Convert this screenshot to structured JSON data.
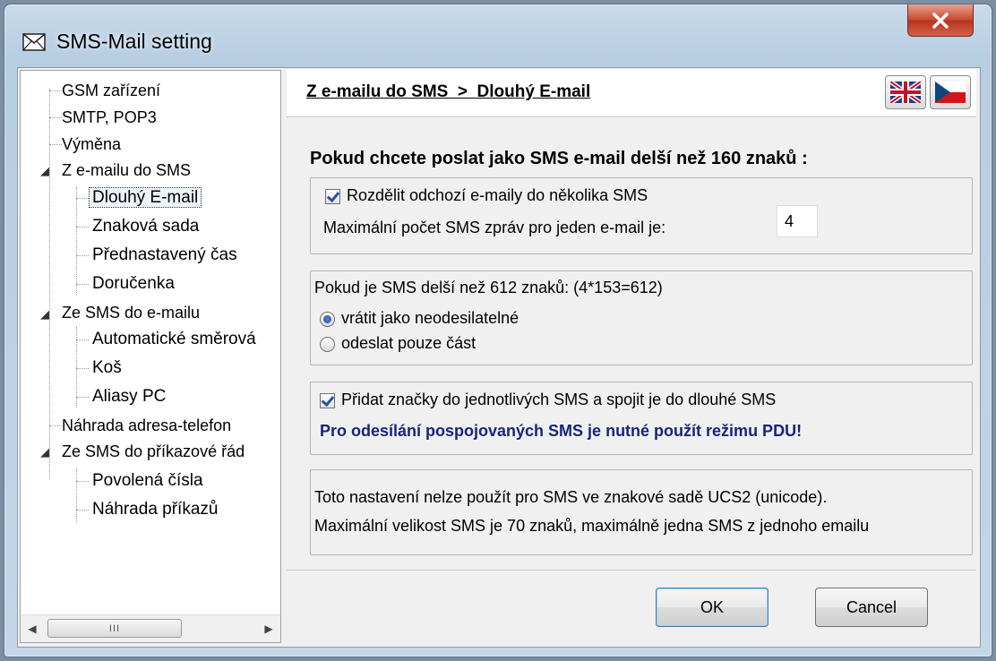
{
  "window": {
    "title": "SMS-Mail setting",
    "icon": "envelope-icon",
    "close_icon": "close-icon"
  },
  "tree": {
    "items": [
      {
        "label": "GSM zařízení",
        "level": 1
      },
      {
        "label": "SMTP, POP3",
        "level": 1
      },
      {
        "label": "Výměna",
        "level": 1
      },
      {
        "label": "Z e-mailu do SMS",
        "level": 1,
        "expanded": true
      },
      {
        "label": "Dlouhý E-mail",
        "level": 2,
        "selected": true
      },
      {
        "label": "Znaková sada",
        "level": 2
      },
      {
        "label": "Přednastavený čas",
        "level": 2
      },
      {
        "label": "Doručenka",
        "level": 2
      },
      {
        "label": "Ze SMS do e-mailu",
        "level": 1,
        "expanded": true
      },
      {
        "label": "Automatické směrová",
        "level": 2
      },
      {
        "label": "Koš",
        "level": 2
      },
      {
        "label": "Aliasy PC",
        "level": 2
      },
      {
        "label": "Náhrada adresa-telefon",
        "level": 1
      },
      {
        "label": "Ze SMS do příkazové řád",
        "level": 1,
        "expanded": true
      },
      {
        "label": "Povolená čísla",
        "level": 2
      },
      {
        "label": "Náhrada příkazů",
        "level": 2
      }
    ],
    "scroll_thumb": "III"
  },
  "header": {
    "breadcrumb": "Z e-mailu do SMS  >  Dlouhý E-mail",
    "flags": [
      "uk-flag-icon",
      "cz-flag-icon"
    ]
  },
  "content": {
    "heading": "Pokud chcete poslat jako SMS e-mail delší než 160 znaků :",
    "split_checkbox_label": "Rozdělit odchozí e-maily do několika SMS",
    "split_checked": true,
    "max_sms_label": "Maximální počet SMS zpráv pro jeden e-mail je:",
    "max_sms_value": "4",
    "longer_text": "Pokud je SMS delší než  612  znaků:  (4*153=612)",
    "radio_return_label": "vrátit jako neodesilatelné",
    "radio_partial_label": "odeslat pouze část",
    "radio_selected": "return",
    "tags_checkbox_label": "Přidat značky do jednotlivých SMS a spojit je do dlouhé SMS",
    "tags_checked": true,
    "pdu_warning": "Pro odesílání pospojovaných SMS je nutné použít režimu PDU!",
    "ucs2_line1": "Toto nastavení nelze použít pro SMS ve znakové sadě UCS2 (unicode).",
    "ucs2_line2": "Maximální velikost SMS je 70 znaků, maximálně jedna SMS z jednoho emailu"
  },
  "buttons": {
    "ok": "OK",
    "cancel": "Cancel"
  },
  "colors": {
    "warning_text": "#1a237e",
    "close_button": "#c64730",
    "title_gradient": "#c9dbeb"
  }
}
